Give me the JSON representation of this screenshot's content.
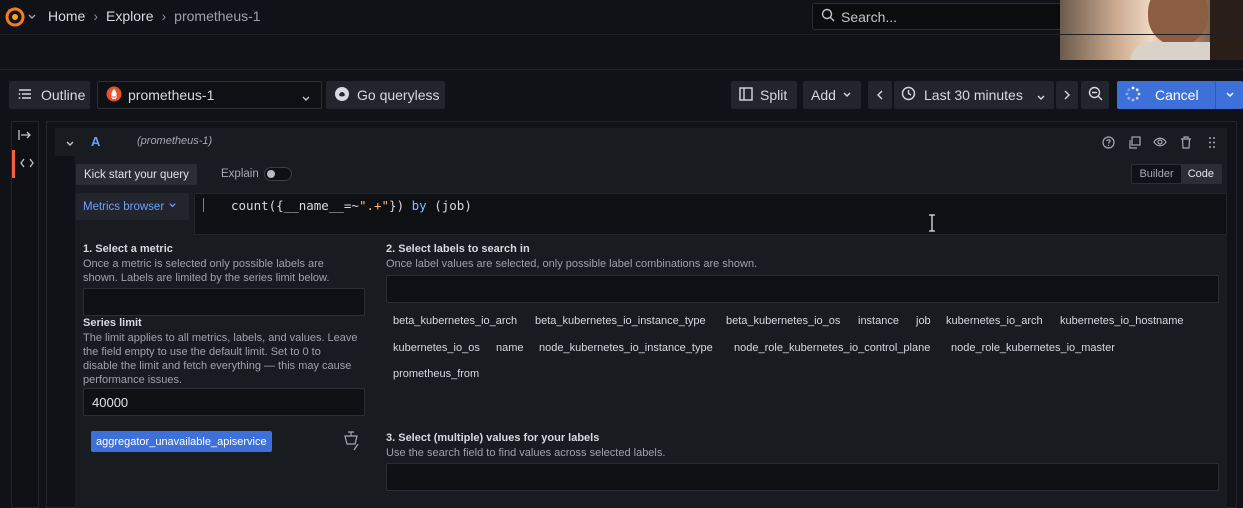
{
  "breadcrumb": {
    "items": [
      "Home",
      "Explore",
      "prometheus-1"
    ]
  },
  "search": {
    "placeholder": "Search..."
  },
  "toolbar": {
    "outline_label": "Outline",
    "datasource": "prometheus-1",
    "queryless_label": "Go queryless",
    "split_label": "Split",
    "add_label": "Add",
    "time_range": "Last 30 minutes",
    "cancel_label": "Cancel"
  },
  "query": {
    "name": "A",
    "datasource": "(prometheus-1)",
    "kick_start_label": "Kick start your query",
    "explain_label": "Explain",
    "mode_builder": "Builder",
    "mode_code": "Code",
    "metrics_browser_label": "Metrics browser",
    "expr": {
      "p1": "count({__name__=~",
      "p2": "\".+\"",
      "p3": "}) ",
      "kw": "by",
      "p4": " (job)"
    }
  },
  "browser": {
    "step1_title": "1. Select a metric",
    "step1_desc": "Once a metric is selected only possible labels are shown. Labels are limited by the series limit below.",
    "series_limit_title": "Series limit",
    "series_limit_desc": "The limit applies to all metrics, labels, and values. Leave the field empty to use the default limit. Set to 0 to disable the limit and fetch everything — this may cause performance issues.",
    "series_limit_value": "40000",
    "selected_metric": "aggregator_unavailable_apiservice",
    "step2_title": "2. Select labels to search in",
    "step2_desc": "Once label values are selected, only possible label combinations are shown.",
    "labels": [
      "beta_kubernetes_io_arch",
      "beta_kubernetes_io_instance_type",
      "beta_kubernetes_io_os",
      "instance",
      "job",
      "kubernetes_io_arch",
      "kubernetes_io_hostname",
      "kubernetes_io_os",
      "name",
      "node_kubernetes_io_instance_type",
      "node_role_kubernetes_io_control_plane",
      "node_role_kubernetes_io_master",
      "prometheus_from"
    ],
    "step3_title": "3. Select (multiple) values for your labels",
    "step3_desc": "Use the search field to find values across selected labels."
  },
  "colors": {
    "accent": "#3d71d9",
    "link": "#6e9fff",
    "datasource_icon": "#e6522c",
    "active_rail": "#f55f3e"
  }
}
